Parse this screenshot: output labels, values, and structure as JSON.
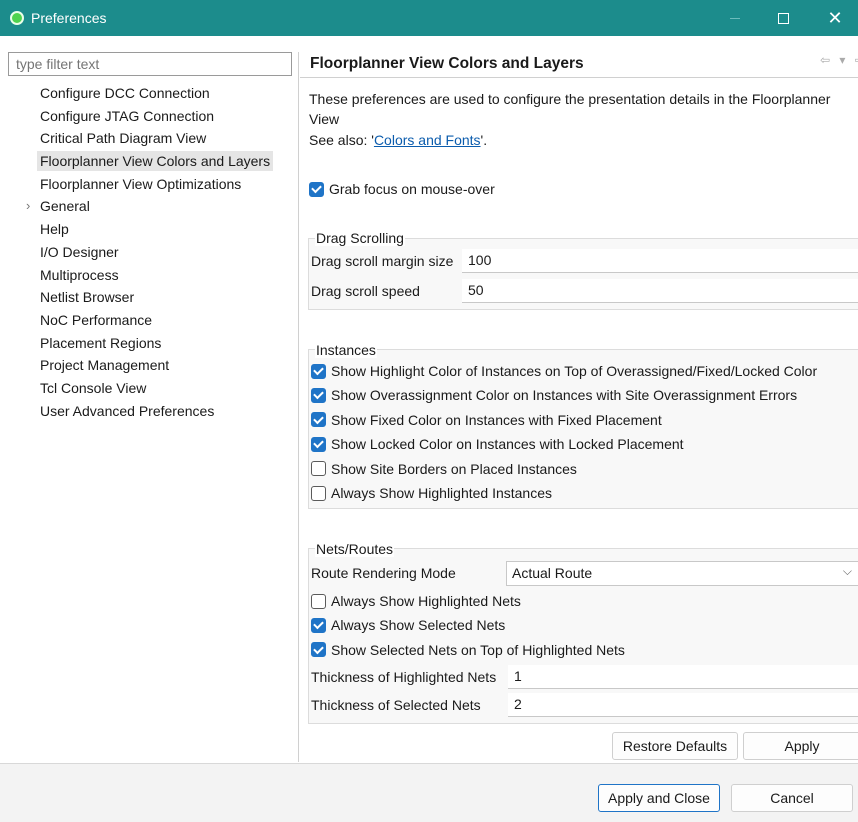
{
  "window": {
    "title": "Preferences",
    "maximize_icon": "maximize-icon",
    "close_glyph": "✕"
  },
  "filter": {
    "placeholder": "type filter text"
  },
  "tree": [
    {
      "label": "Configure DCC Connection"
    },
    {
      "label": "Configure JTAG Connection"
    },
    {
      "label": "Critical Path Diagram View"
    },
    {
      "label": "Floorplanner View Colors and Layers",
      "selected": true
    },
    {
      "label": "Floorplanner View Optimizations"
    },
    {
      "label": "General",
      "expandable": true
    },
    {
      "label": "Help"
    },
    {
      "label": "I/O Designer"
    },
    {
      "label": "Multiprocess"
    },
    {
      "label": "Netlist Browser"
    },
    {
      "label": "NoC Performance"
    },
    {
      "label": "Placement Regions"
    },
    {
      "label": "Project Management"
    },
    {
      "label": "Tcl Console View"
    },
    {
      "label": "User Advanced Preferences"
    }
  ],
  "page": {
    "title": "Floorplanner View Colors and Layers",
    "nav_icons": "⇦ ▾ ⇨ ▾ ⁝",
    "description": "These preferences are used to configure the presentation details in the Floorplanner View",
    "see_also_prefix": "See also: '",
    "see_also_link": "Colors and Fonts",
    "see_also_suffix": "'.",
    "grab_focus": {
      "label": "Grab focus on mouse-over",
      "checked": true
    }
  },
  "drag_scrolling": {
    "title": "Drag Scrolling",
    "margin_label": "Drag scroll margin size",
    "margin_value": "100",
    "speed_label": "Drag scroll speed",
    "speed_value": "50"
  },
  "instances": {
    "title": "Instances",
    "options": [
      {
        "label": "Show Highlight Color of Instances on Top of Overassigned/Fixed/Locked Color",
        "checked": true
      },
      {
        "label": "Show Overassignment Color on Instances with Site Overassignment Errors",
        "checked": true
      },
      {
        "label": "Show Fixed Color on Instances with Fixed Placement",
        "checked": true
      },
      {
        "label": "Show Locked Color on Instances with Locked Placement",
        "checked": true
      },
      {
        "label": "Show Site Borders on Placed Instances",
        "checked": false
      },
      {
        "label": "Always Show Highlighted Instances",
        "checked": false
      }
    ]
  },
  "nets": {
    "title": "Nets/Routes",
    "route_mode_label": "Route Rendering Mode",
    "route_mode_value": "Actual Route",
    "options": [
      {
        "label": "Always Show Highlighted Nets",
        "checked": false
      },
      {
        "label": "Always Show Selected Nets",
        "checked": true
      },
      {
        "label": "Show Selected Nets on Top of Highlighted Nets",
        "checked": true
      }
    ],
    "thick_hl_label": "Thickness of Highlighted Nets",
    "thick_hl_value": "1",
    "thick_sel_label": "Thickness of Selected Nets",
    "thick_sel_value": "2"
  },
  "buttons": {
    "restore": "Restore Defaults",
    "apply": "Apply",
    "apply_close": "Apply and Close",
    "cancel": "Cancel"
  },
  "colors": {
    "titlebar": "#1c8c8c",
    "accent": "#1f74c7",
    "link": "#0b5cad"
  }
}
